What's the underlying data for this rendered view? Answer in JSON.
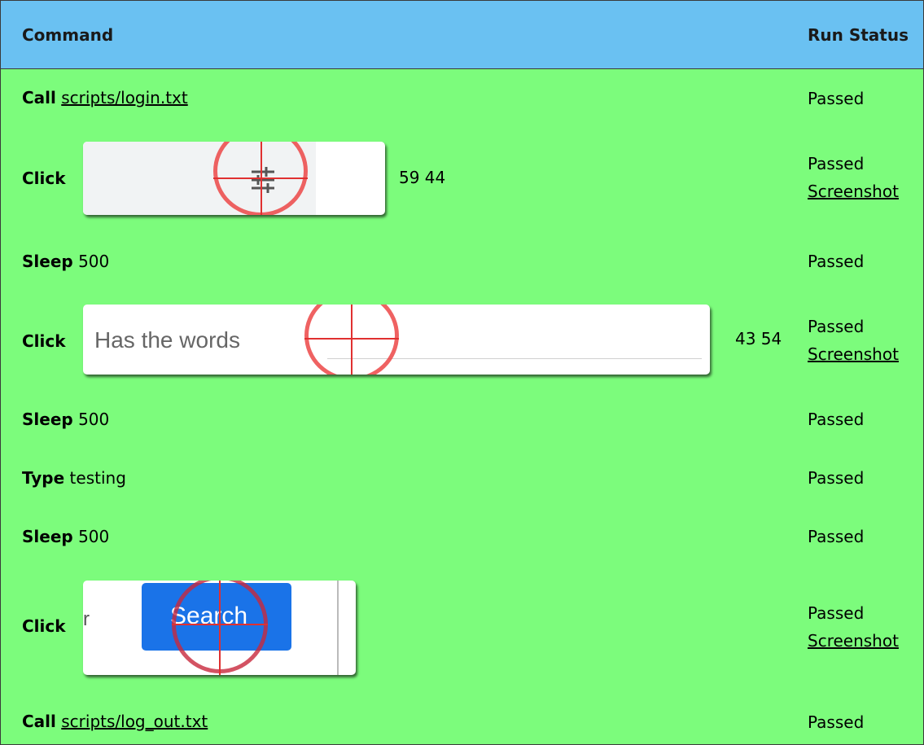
{
  "header": {
    "command_label": "Command",
    "status_label": "Run Status"
  },
  "rows": [
    {
      "keyword": "Call",
      "argument": "scripts/login.txt",
      "status": "Passed"
    },
    {
      "keyword": "Click",
      "coords": "59 44",
      "status": "Passed",
      "screenshot_link": "Screenshot"
    },
    {
      "keyword": "Sleep",
      "argument": "500",
      "status": "Passed"
    },
    {
      "keyword": "Click",
      "thumb_text": "Has the words",
      "coords": "43 54",
      "status": "Passed",
      "screenshot_link": "Screenshot"
    },
    {
      "keyword": "Sleep",
      "argument": "500",
      "status": "Passed"
    },
    {
      "keyword": "Type",
      "argument": "testing",
      "status": "Passed"
    },
    {
      "keyword": "Sleep",
      "argument": "500",
      "status": "Passed"
    },
    {
      "keyword": "Click",
      "thumb_text_left": "r",
      "thumb_button": "Search",
      "status": "Passed",
      "screenshot_link": "Screenshot"
    },
    {
      "keyword": "Call",
      "argument": "scripts/log_out.txt",
      "status": "Passed"
    }
  ],
  "colors": {
    "header_bg": "#6ac1f2",
    "body_bg": "#7cfc7c",
    "target_ring": "#ec4646",
    "search_button": "#1a73e8"
  },
  "icons": {
    "row_1_thumb": "filter-sliders-icon",
    "target": "crosshair-target-icon"
  }
}
